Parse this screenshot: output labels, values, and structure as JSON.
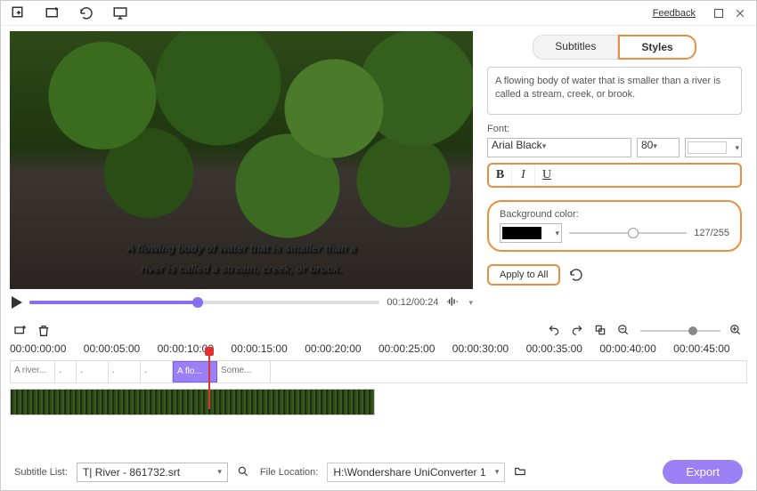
{
  "topbar": {
    "feedback": "Feedback"
  },
  "preview": {
    "subtitle_line1": "A flowing body of water that is smaller than a",
    "subtitle_line2": "river is called a stream, creek, or brook.",
    "time": "00:12/00:24"
  },
  "tabs": {
    "subtitles": "Subtitles",
    "styles": "Styles"
  },
  "side": {
    "subtitle_text": "A flowing body of water that is smaller than a river is called a stream, creek, or brook.",
    "font_label": "Font:",
    "font_name": "Arial Black",
    "font_size": "80",
    "bg_label": "Background color:",
    "opacity": "127/255",
    "apply": "Apply to All"
  },
  "timeline": {
    "ticks": [
      "00:00:00:00",
      "00:00:05:00",
      "00:00:10:00",
      "00:00:15:00",
      "00:00:20:00",
      "00:00:25:00",
      "00:00:30:00",
      "00:00:35:00",
      "00:00:40:00",
      "00:00:45:00"
    ],
    "clips": [
      "A river...",
      ".",
      ".",
      ".",
      ".",
      "A flo...",
      "Some..."
    ]
  },
  "bottom": {
    "sublist_label": "Subtitle List:",
    "sublist_value": "T| River - 861732.srt",
    "loc_label": "File Location:",
    "loc_value": "H:\\Wondershare UniConverter 1",
    "export": "Export"
  }
}
